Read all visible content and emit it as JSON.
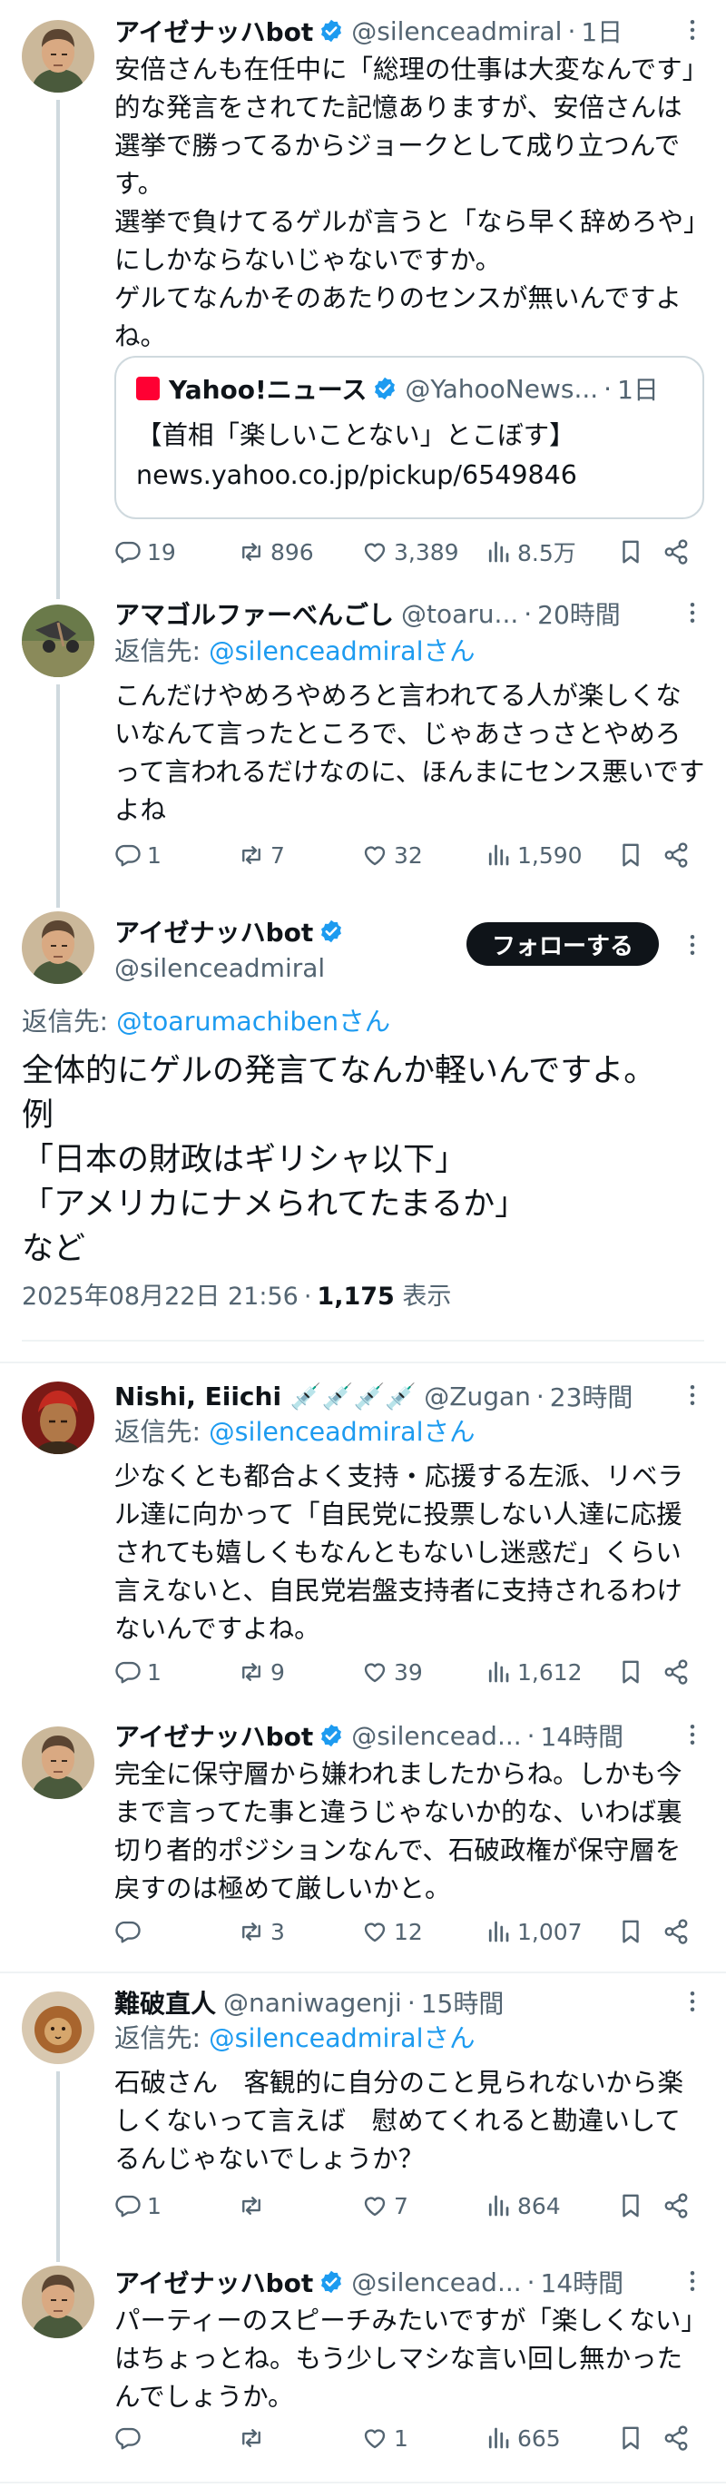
{
  "colors": {
    "accent": "#1d9bf0",
    "text": "#0f1419",
    "muted": "#536471",
    "divider": "#eff3f4"
  },
  "reply_prefix": "返信先:",
  "tweets": {
    "t1": {
      "name": "アイゼナッハbot",
      "handle": "@silenceadmiral",
      "time": "1日",
      "text": "安倍さんも在任中に「総理の仕事は大変なんです」的な発言をされてた記憶ありますが、安倍さんは選挙で勝ってるからジョークとして成り立つんです。\n選挙で負けてるゲルが言うと「なら早く辞めろや」にしかならないじゃないですか。\nゲルてなんかそのあたりのセンスが無いんですよね。",
      "quote": {
        "source": "Yahoo!ニュース",
        "handle": "@YahooNews...",
        "time": "1日",
        "title": "【首相「楽しいことない」とこぼす】",
        "url": "news.yahoo.co.jp/pickup/6549846"
      },
      "stats": {
        "replies": "19",
        "retweets": "896",
        "likes": "3,389",
        "views": "8.5万"
      }
    },
    "t2": {
      "name": "アマゴルファーべんごし",
      "handle": "@toaru...",
      "time": "20時間",
      "reply_to": "@silenceadmiralさん",
      "text": "こんだけやめろやめろと言われてる人が楽しくないなんて言ったところで、じゃあさっさとやめろって言われるだけなのに、ほんまにセンス悪いですよね",
      "stats": {
        "replies": "1",
        "retweets": "7",
        "likes": "32",
        "views": "1,590"
      }
    },
    "main": {
      "name": "アイゼナッハbot",
      "handle": "@silenceadmiral",
      "follow": "フォローする",
      "reply_to": "@toarumachibenさん",
      "text": "全体的にゲルの発言てなんか軽いんですよ。\n例\n「日本の財政はギリシャ以下」\n「アメリカにナメられてたまるか」\nなど",
      "date": "2025年08月22日 21:56",
      "views": "1,175",
      "views_label": "表示"
    },
    "t3": {
      "name": "Nishi, Eiichi 💉💉💉💉",
      "handle": "@Zugan",
      "time": "23時間",
      "reply_to": "@silenceadmiralさん",
      "text": "少なくとも都合よく支持・応援する左派、リベラル達に向かって「自民党に投票しない人達に応援されても嬉しくもなんともないし迷惑だ」くらい言えないと、自民党岩盤支持者に支持されるわけないんですよね。",
      "stats": {
        "replies": "1",
        "retweets": "9",
        "likes": "39",
        "views": "1,612"
      }
    },
    "t4": {
      "name": "アイゼナッハbot",
      "handle": "@silencead...",
      "time": "14時間",
      "text": "完全に保守層から嫌われましたからね。しかも今まで言ってた事と違うじゃないか的な、いわば裏切り者的ポジションなんで、石破政権が保守層を戻すのは極めて厳しいかと。",
      "stats": {
        "replies": "",
        "retweets": "3",
        "likes": "12",
        "views": "1,007"
      }
    },
    "t5": {
      "name": "難破直人",
      "handle": "@naniwagenji",
      "time": "15時間",
      "reply_to": "@silenceadmiralさん",
      "text": "石破さん　客観的に自分のこと見られないから楽しくないって言えば　慰めてくれると勘違いしてるんじゃないでしょうか？",
      "stats": {
        "replies": "1",
        "retweets": "",
        "likes": "7",
        "views": "864"
      }
    },
    "t6": {
      "name": "アイゼナッハbot",
      "handle": "@silencead...",
      "time": "14時間",
      "text": "パーティーのスピーチみたいですが「楽しくない」はちょっとね。もう少しマシな言い回し無かったんでしょうか。",
      "stats": {
        "replies": "",
        "retweets": "",
        "likes": "1",
        "views": "665"
      }
    }
  }
}
